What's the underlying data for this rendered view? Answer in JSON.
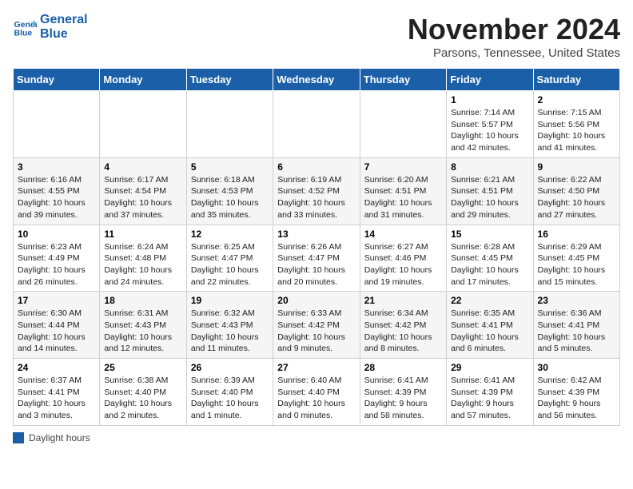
{
  "header": {
    "logo_line1": "General",
    "logo_line2": "Blue",
    "month": "November 2024",
    "location": "Parsons, Tennessee, United States"
  },
  "days_of_week": [
    "Sunday",
    "Monday",
    "Tuesday",
    "Wednesday",
    "Thursday",
    "Friday",
    "Saturday"
  ],
  "legend": {
    "label": "Daylight hours"
  },
  "weeks": [
    [
      {
        "num": "",
        "info": ""
      },
      {
        "num": "",
        "info": ""
      },
      {
        "num": "",
        "info": ""
      },
      {
        "num": "",
        "info": ""
      },
      {
        "num": "",
        "info": ""
      },
      {
        "num": "1",
        "info": "Sunrise: 7:14 AM\nSunset: 5:57 PM\nDaylight: 10 hours and 42 minutes."
      },
      {
        "num": "2",
        "info": "Sunrise: 7:15 AM\nSunset: 5:56 PM\nDaylight: 10 hours and 41 minutes."
      }
    ],
    [
      {
        "num": "3",
        "info": "Sunrise: 6:16 AM\nSunset: 4:55 PM\nDaylight: 10 hours and 39 minutes."
      },
      {
        "num": "4",
        "info": "Sunrise: 6:17 AM\nSunset: 4:54 PM\nDaylight: 10 hours and 37 minutes."
      },
      {
        "num": "5",
        "info": "Sunrise: 6:18 AM\nSunset: 4:53 PM\nDaylight: 10 hours and 35 minutes."
      },
      {
        "num": "6",
        "info": "Sunrise: 6:19 AM\nSunset: 4:52 PM\nDaylight: 10 hours and 33 minutes."
      },
      {
        "num": "7",
        "info": "Sunrise: 6:20 AM\nSunset: 4:51 PM\nDaylight: 10 hours and 31 minutes."
      },
      {
        "num": "8",
        "info": "Sunrise: 6:21 AM\nSunset: 4:51 PM\nDaylight: 10 hours and 29 minutes."
      },
      {
        "num": "9",
        "info": "Sunrise: 6:22 AM\nSunset: 4:50 PM\nDaylight: 10 hours and 27 minutes."
      }
    ],
    [
      {
        "num": "10",
        "info": "Sunrise: 6:23 AM\nSunset: 4:49 PM\nDaylight: 10 hours and 26 minutes."
      },
      {
        "num": "11",
        "info": "Sunrise: 6:24 AM\nSunset: 4:48 PM\nDaylight: 10 hours and 24 minutes."
      },
      {
        "num": "12",
        "info": "Sunrise: 6:25 AM\nSunset: 4:47 PM\nDaylight: 10 hours and 22 minutes."
      },
      {
        "num": "13",
        "info": "Sunrise: 6:26 AM\nSunset: 4:47 PM\nDaylight: 10 hours and 20 minutes."
      },
      {
        "num": "14",
        "info": "Sunrise: 6:27 AM\nSunset: 4:46 PM\nDaylight: 10 hours and 19 minutes."
      },
      {
        "num": "15",
        "info": "Sunrise: 6:28 AM\nSunset: 4:45 PM\nDaylight: 10 hours and 17 minutes."
      },
      {
        "num": "16",
        "info": "Sunrise: 6:29 AM\nSunset: 4:45 PM\nDaylight: 10 hours and 15 minutes."
      }
    ],
    [
      {
        "num": "17",
        "info": "Sunrise: 6:30 AM\nSunset: 4:44 PM\nDaylight: 10 hours and 14 minutes."
      },
      {
        "num": "18",
        "info": "Sunrise: 6:31 AM\nSunset: 4:43 PM\nDaylight: 10 hours and 12 minutes."
      },
      {
        "num": "19",
        "info": "Sunrise: 6:32 AM\nSunset: 4:43 PM\nDaylight: 10 hours and 11 minutes."
      },
      {
        "num": "20",
        "info": "Sunrise: 6:33 AM\nSunset: 4:42 PM\nDaylight: 10 hours and 9 minutes."
      },
      {
        "num": "21",
        "info": "Sunrise: 6:34 AM\nSunset: 4:42 PM\nDaylight: 10 hours and 8 minutes."
      },
      {
        "num": "22",
        "info": "Sunrise: 6:35 AM\nSunset: 4:41 PM\nDaylight: 10 hours and 6 minutes."
      },
      {
        "num": "23",
        "info": "Sunrise: 6:36 AM\nSunset: 4:41 PM\nDaylight: 10 hours and 5 minutes."
      }
    ],
    [
      {
        "num": "24",
        "info": "Sunrise: 6:37 AM\nSunset: 4:41 PM\nDaylight: 10 hours and 3 minutes."
      },
      {
        "num": "25",
        "info": "Sunrise: 6:38 AM\nSunset: 4:40 PM\nDaylight: 10 hours and 2 minutes."
      },
      {
        "num": "26",
        "info": "Sunrise: 6:39 AM\nSunset: 4:40 PM\nDaylight: 10 hours and 1 minute."
      },
      {
        "num": "27",
        "info": "Sunrise: 6:40 AM\nSunset: 4:40 PM\nDaylight: 10 hours and 0 minutes."
      },
      {
        "num": "28",
        "info": "Sunrise: 6:41 AM\nSunset: 4:39 PM\nDaylight: 9 hours and 58 minutes."
      },
      {
        "num": "29",
        "info": "Sunrise: 6:41 AM\nSunset: 4:39 PM\nDaylight: 9 hours and 57 minutes."
      },
      {
        "num": "30",
        "info": "Sunrise: 6:42 AM\nSunset: 4:39 PM\nDaylight: 9 hours and 56 minutes."
      }
    ]
  ]
}
